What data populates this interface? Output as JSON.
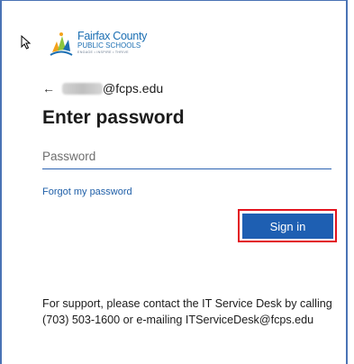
{
  "logo": {
    "line1": "Fairfax County",
    "line2": "PUBLIC SCHOOLS",
    "line3": "ENGAGE • INSPIRE • THRIVE"
  },
  "identity": {
    "back_icon": "back-arrow-icon",
    "email_domain": "@fcps.edu"
  },
  "title": "Enter password",
  "password_field": {
    "placeholder": "Password",
    "value": ""
  },
  "forgot_link": "Forgot my password",
  "signin_button": "Sign in",
  "support_text": "For support, please contact the IT Service Desk by calling (703) 503-1600 or e-mailing ITServiceDesk@fcps.edu",
  "colors": {
    "accent": "#1e5fb2",
    "highlight": "#e3141f",
    "link": "#1f5fa8"
  }
}
